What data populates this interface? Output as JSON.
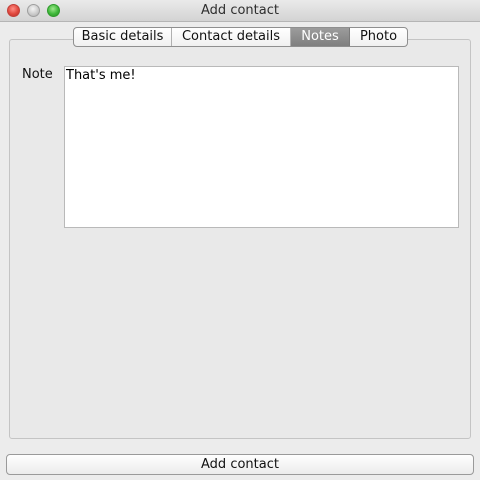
{
  "window": {
    "title": "Add contact",
    "controls": {
      "close": "close-icon",
      "minimize": "minimize-icon",
      "zoom": "zoom-icon"
    }
  },
  "tabs": [
    {
      "label": "Basic details",
      "active": false
    },
    {
      "label": "Contact details",
      "active": false
    },
    {
      "label": "Notes",
      "active": true
    },
    {
      "label": "Photo",
      "active": false
    }
  ],
  "notes": {
    "label": "Note",
    "value": "That's me!"
  },
  "footer": {
    "add_label": "Add contact"
  },
  "colors": {
    "background": "#ececec",
    "active_tab": "#8c8c8c",
    "close": "#e0483e",
    "minimize": "#c9c9c9",
    "zoom": "#3fb83a"
  }
}
